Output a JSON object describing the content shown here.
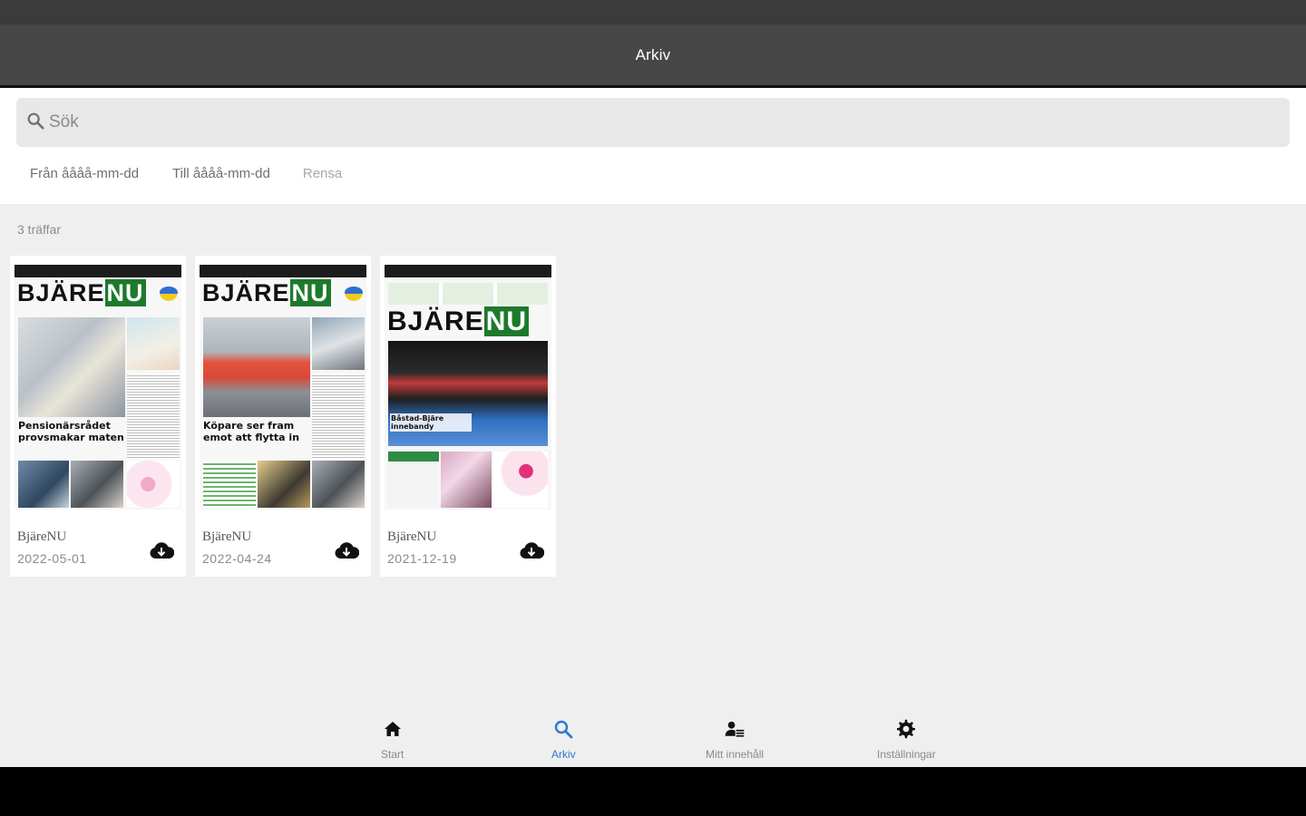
{
  "app": {
    "title": "Arkiv"
  },
  "search": {
    "placeholder": "Sök"
  },
  "filters": {
    "from": "Från åååå-mm-dd",
    "to": "Till åååå-mm-dd",
    "clear": "Rensa"
  },
  "results": {
    "count_label": "3 träffar"
  },
  "issues": [
    {
      "title": "BjäreNU",
      "date": "2022-05-01",
      "cover": {
        "masthead": "BJÄRE",
        "masthead_accent": "NU",
        "headline": "Pensionärsrådet provsmakar maten"
      }
    },
    {
      "title": "BjäreNU",
      "date": "2022-04-24",
      "cover": {
        "masthead": "BJÄRE",
        "masthead_accent": "NU",
        "headline": "Köpare ser fram emot att flytta in"
      }
    },
    {
      "title": "BjäreNU",
      "date": "2021-12-19",
      "cover": {
        "masthead": "BJÄRE",
        "masthead_accent": "NU",
        "headline": "Båstad-Bjäre innebandy"
      }
    }
  ],
  "nav": [
    {
      "label": "Start",
      "icon": "home-icon",
      "active": false
    },
    {
      "label": "Arkiv",
      "icon": "search-icon",
      "active": true
    },
    {
      "label": "Mitt innehåll",
      "icon": "user-content-icon",
      "active": false
    },
    {
      "label": "Inställningar",
      "icon": "gear-icon",
      "active": false
    }
  ],
  "colors": {
    "accent": "#2f78d6",
    "app_bar": "#474747",
    "brand_green": "#1d7a2c"
  }
}
